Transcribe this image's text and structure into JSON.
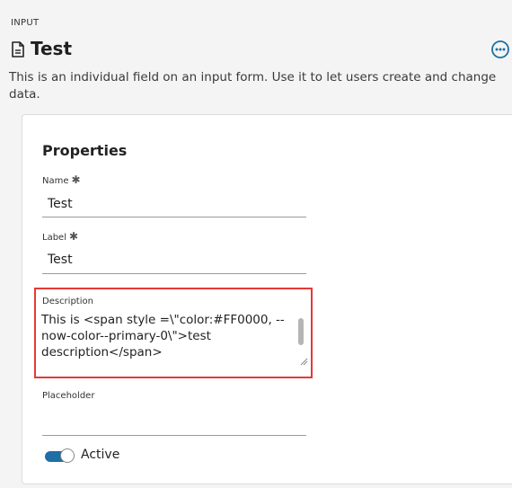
{
  "header": {
    "eyebrow": "INPUT",
    "title": "Test",
    "title_icon": "document-icon",
    "more_icon": "more-options-icon",
    "description": "This is an individual field on an input form. Use it to let users create and change data."
  },
  "properties": {
    "heading": "Properties",
    "name": {
      "label": "Name",
      "required_mark": "✱",
      "value": "Test"
    },
    "label": {
      "label": "Label",
      "required_mark": "✱",
      "value": "Test"
    },
    "description": {
      "label": "Description",
      "value": "This is <span style =\\\"color:#FF0000, --now-color--primary-0\\\">test description</span>"
    },
    "placeholder": {
      "label": "Placeholder",
      "value": ""
    },
    "active": {
      "label": "Active",
      "checked": true
    }
  },
  "colors": {
    "accent": "#1d6fa5",
    "highlight_border": "#e53935"
  }
}
